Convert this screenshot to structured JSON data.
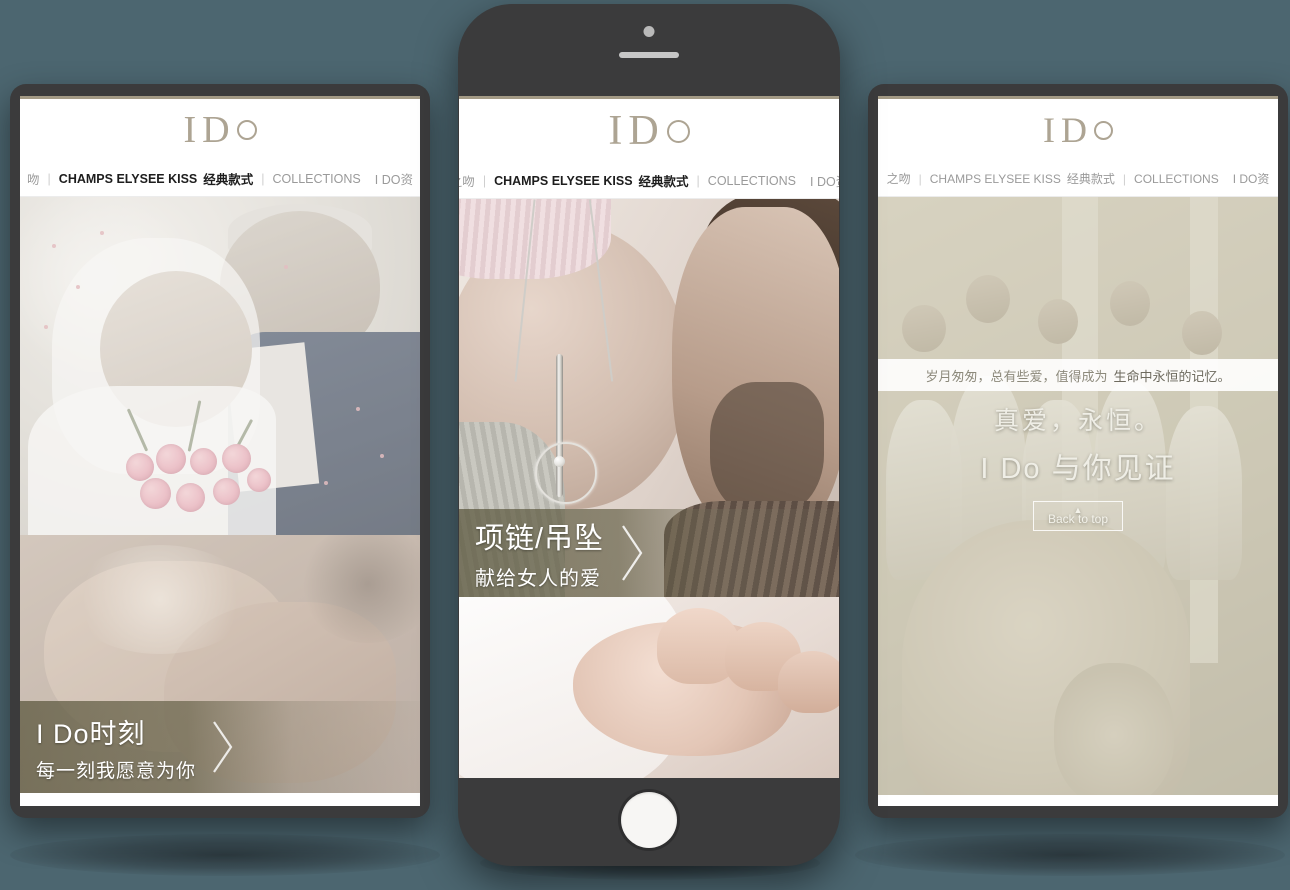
{
  "page": {
    "background_color": "#4c6670",
    "device_frame_color": "#3b3b3c",
    "brand_accent_color": "#ada493"
  },
  "brand": {
    "logo_text_i": "I",
    "logo_text_d": "D",
    "logo_ring": "o-ring-glyph"
  },
  "nav": {
    "items": [
      {
        "label": "之吻",
        "state": "muted"
      },
      {
        "label": "CHAMPS ELYSEE KISS",
        "label_cn": "经典款式",
        "state": "active"
      },
      {
        "label": "COLLECTIONS",
        "state": "muted"
      },
      {
        "label": "I DO资",
        "state": "muted"
      }
    ],
    "separator": "|",
    "left_device_items": [
      {
        "label": "吻",
        "state": "muted"
      },
      {
        "label": "CHAMPS ELYSEE KISS",
        "label_cn": "经典款式",
        "state": "active"
      },
      {
        "label": "COLLECTIONS",
        "state": "muted"
      },
      {
        "label": "I DO资",
        "state": "muted"
      }
    ]
  },
  "left_device": {
    "type": "tablet",
    "hero_caption": {
      "title": "I Do时刻",
      "subtitle": "每一刻我愿意为你",
      "chevron": "chevron-right-icon"
    },
    "photo_top_alt": "older-couple-wedding-bouquet",
    "photo_bottom_alt": "holding-hands-closeup"
  },
  "center_device": {
    "type": "phone",
    "hardware": {
      "camera": "front-camera-dot",
      "speaker": "earpiece-speaker",
      "home_button": "home-button"
    },
    "hero_caption": {
      "title": "项链/吊坠",
      "subtitle": "献给女人的爱",
      "chevron": "chevron-right-icon"
    },
    "photo_top_alt": "pendant-necklace-pregnant-belly-kiss",
    "photo_bottom_alt": "baby-hand-closeup"
  },
  "right_device": {
    "type": "tablet",
    "quote": {
      "lead": "岁月匆匆，总有些爱，值得成为",
      "emphasis": "生命中永恒的记忆。"
    },
    "headline": {
      "line1": "真爱，永恒。",
      "line2": "I Do 与你见证"
    },
    "back_to_top": {
      "label": "Back to top",
      "arrow_icon": "caret-up-icon"
    },
    "photo_alt": "wedding-ceremony-crowd"
  }
}
